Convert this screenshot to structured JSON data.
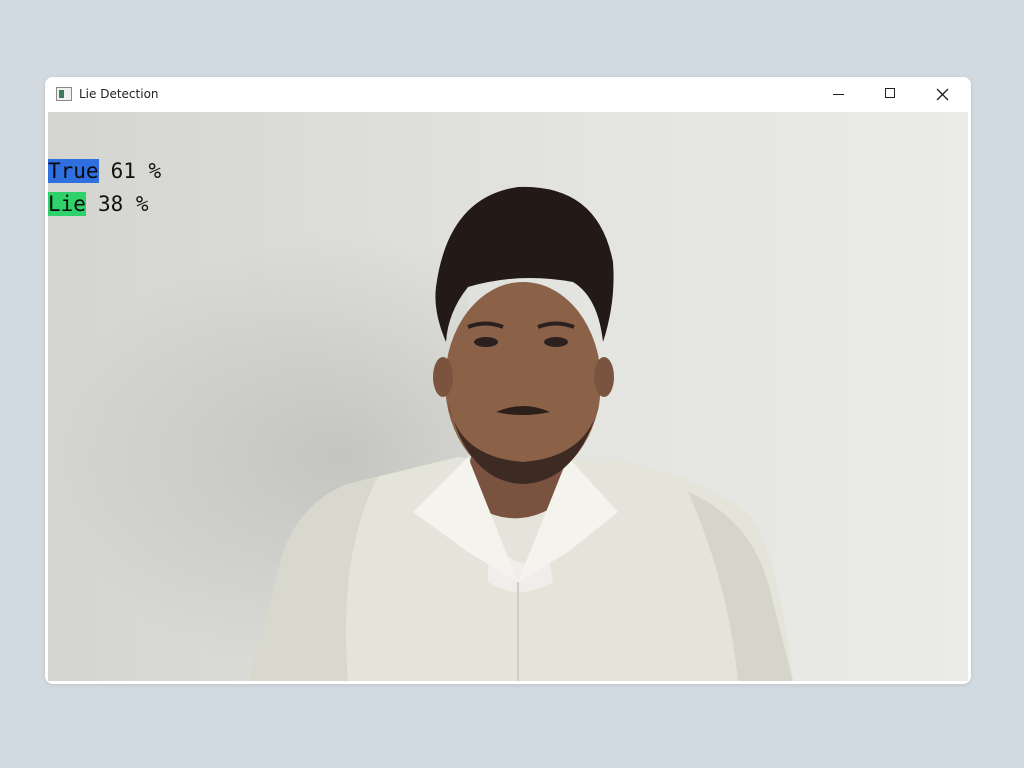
{
  "window": {
    "title": "Lie Detection",
    "icon": "opencv-window-icon",
    "controls": {
      "minimize": "minimize-icon",
      "maximize": "maximize-icon",
      "close": "close-icon"
    }
  },
  "overlay": {
    "true_label": "True",
    "true_value": "61 %",
    "lie_label": "Lie",
    "lie_value": "38 %",
    "true_color": "#2f6fe0",
    "lie_color": "#2fd26a"
  }
}
